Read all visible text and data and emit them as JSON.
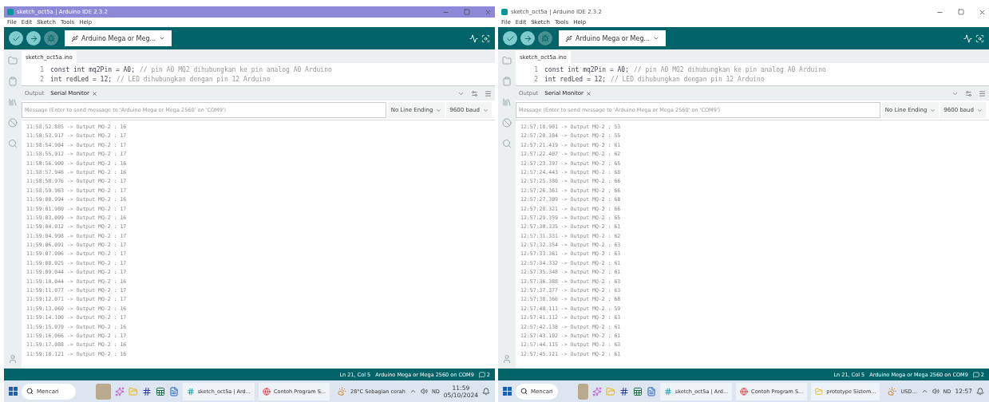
{
  "windows": [
    {
      "title": "sketch_oct5a | Arduino IDE 2.3.2",
      "active": true,
      "menu": [
        "File",
        "Edit",
        "Sketch",
        "Tools",
        "Help"
      ],
      "board": "Arduino Mega or Meg...",
      "file_tab": "sketch_oct5a.ino",
      "code": [
        {
          "number": "1",
          "code": "const int mq2Pin = A0;",
          "comment": "// pin A0 MQ2 dihubungkan ke pin analog A0 Arduino"
        },
        {
          "number": "2",
          "code": "int redLed = 12;",
          "comment": "// LED dihubungkan dengan pin 12 Arduino"
        }
      ],
      "output_tabs": [
        {
          "label": "Output",
          "selected": false
        },
        {
          "label": "Serial Monitor",
          "selected": true
        }
      ],
      "message": {
        "placeholder": "Message (Enter to send message to 'Arduino Mega or Mega 2560' on 'COM9')"
      },
      "line_ending": "No Line Ending",
      "baud": "9600 baud",
      "log": [
        "11:58:52.885 -> Output MQ-2 : 16",
        "11:58:53.917 -> Output MQ-2 : 17",
        "11:58:54.904 -> Output MQ-2 : 17",
        "11:58:55.912 -> Output MQ-2 : 17",
        "11:58:56.900 -> Output MQ-2 : 16",
        "11:58:57.946 -> Output MQ-2 : 16",
        "11:58:58.976 -> Output MQ-2 : 17",
        "11:58:59.963 -> Output MQ-2 : 17",
        "11:59:00.994 -> Output MQ-2 : 16",
        "11:59:01.980 -> Output MQ-2 : 17",
        "11:59:03.009 -> Output MQ-2 : 16",
        "11:59:04.012 -> Output MQ-2 : 17",
        "11:59:04.998 -> Output MQ-2 : 17",
        "11:59:06.091 -> Output MQ-2 : 17",
        "11:59:07.006 -> Output MQ-2 : 17",
        "11:59:08.025 -> Output MQ-2 : 17",
        "11:59:09.044 -> Output MQ-2 : 17",
        "11:59:10.044 -> Output MQ-2 : 16",
        "11:59:11.077 -> Output MQ-2 : 17",
        "11:59:12.071 -> Output MQ-2 : 17",
        "11:59:13.060 -> Output MQ-2 : 16",
        "11:59:14.100 -> Output MQ-2 : 17",
        "11:59:15.070 -> Output MQ-2 : 16",
        "11:59:16.066 -> Output MQ-2 : 17",
        "11:59:17.088 -> Output MQ-2 : 16",
        "11:59:18.121 -> Output MQ-2 : 16"
      ],
      "status": {
        "position": "Ln 21, Col 5",
        "board": "Arduino Mega or Mega 2560 on COM9",
        "notifications": "2"
      },
      "taskbar": {
        "search": "Mencari",
        "windows": [
          {
            "kind": "arduino",
            "label": "sketch_oct5a | Ard..."
          },
          {
            "kind": "chrome",
            "label": "Contoh Program S..."
          }
        ],
        "widget": "28°C Sebagian cerah",
        "language": "ND",
        "time": "11:59",
        "date": "05/10/2024"
      }
    },
    {
      "title": "sketch_oct5a | Arduino IDE 2.3.2",
      "active": false,
      "menu": [
        "File",
        "Edit",
        "Sketch",
        "Tools",
        "Help"
      ],
      "board": "Arduino Mega or Meg...",
      "file_tab": "sketch_oct5a.ino",
      "code": [
        {
          "number": "1",
          "code": "const int mq2Pin = A0;",
          "comment": "// pin A0 MQ2 dihubungkan ke pin analog A0 Arduino"
        },
        {
          "number": "2",
          "code": "int redLed = 12;",
          "comment": "// LED dihubungkan dengan pin 12 Arduino"
        }
      ],
      "output_tabs": [
        {
          "label": "Output",
          "selected": false
        },
        {
          "label": "Serial Monitor",
          "selected": true
        }
      ],
      "message": {
        "placeholder": "Message (Enter to send message to 'Arduino Mega or Mega 2560' on 'COM9')"
      },
      "line_ending": "No Line Ending",
      "baud": "9600 baud",
      "log": [
        "12:57:18.901 -> Output MQ-2 : 53",
        "12:57:20.384 -> Output MQ-2 : 55",
        "12:57:21.419 -> Output MQ-2 : 61",
        "12:57:22.407 -> Output MQ-2 : 62",
        "12:57:23.397 -> Output MQ-2 : 65",
        "12:57:24.443 -> Output MQ-2 : 68",
        "12:57:25.380 -> Output MQ-2 : 66",
        "12:57:26.361 -> Output MQ-2 : 66",
        "12:57:27.309 -> Output MQ-2 : 68",
        "12:57:28.321 -> Output MQ-2 : 66",
        "12:57:29.359 -> Output MQ-2 : 65",
        "12:57:30.335 -> Output MQ-2 : 61",
        "12:57:31.331 -> Output MQ-2 : 62",
        "12:57:32.354 -> Output MQ-2 : 63",
        "12:57:33.361 -> Output MQ-2 : 63",
        "12:57:34.332 -> Output MQ-2 : 61",
        "12:57:35.348 -> Output MQ-2 : 61",
        "12:57:36.388 -> Output MQ-2 : 63",
        "12:57:37.377 -> Output MQ-2 : 63",
        "12:57:38.366 -> Output MQ-2 : 68",
        "12:57:40.111 -> Output MQ-2 : 59",
        "12:57:41.112 -> Output MQ-2 : 63",
        "12:57:42.138 -> Output MQ-2 : 61",
        "12:57:43.102 -> Output MQ-2 : 61",
        "12:57:44.115 -> Output MQ-2 : 63",
        "12:57:45.121 -> Output MQ-2 : 61"
      ],
      "status": {
        "position": "Ln 21, Col 5",
        "board": "Arduino Mega or Mega 2560 on COM9",
        "notifications": "2"
      },
      "taskbar": {
        "search": "Mencari",
        "windows": [
          {
            "kind": "arduino",
            "label": "sketch_oct5a | Ard..."
          },
          {
            "kind": "chrome",
            "label": "Contoh Program S..."
          },
          {
            "kind": "folder",
            "label": "prototype Sistem..."
          }
        ],
        "widget": "USD...",
        "language": "ND",
        "time": "12:57"
      }
    }
  ]
}
